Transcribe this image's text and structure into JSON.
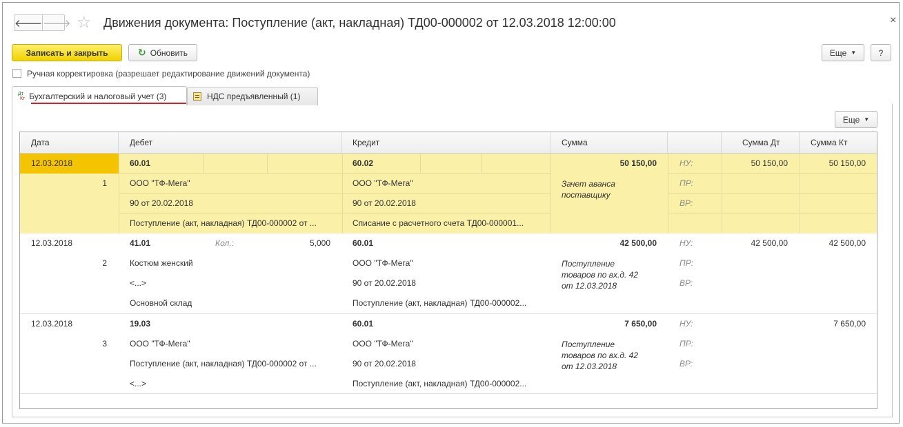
{
  "window": {
    "title": "Движения документа: Поступление (акт, накладная) ТД00-000002 от 12.03.2018 12:00:00",
    "close_glyph": "×",
    "back_glyph": "🡐",
    "forward_glyph": "🡒",
    "star_glyph": "☆"
  },
  "toolbar": {
    "save_close": "Записать и закрыть",
    "refresh": "Обновить",
    "more": "Еще",
    "help": "?"
  },
  "manual_correction": {
    "label": "Ручная корректировка (разрешает редактирование движений документа)",
    "checked": false
  },
  "tabs": [
    {
      "label": "Бухгалтерский и налоговый учет (3)",
      "icon": "dt-kt-icon",
      "active": true
    },
    {
      "label": "НДС предъявленный (1)",
      "icon": "vat-register-icon",
      "active": false
    }
  ],
  "tab_icon_text": {
    "dt": "Дт",
    "kt": "Кт"
  },
  "table": {
    "more": "Еще",
    "columns": {
      "date": "Дата",
      "debit": "Дебет",
      "credit": "Кредит",
      "sum": "Сумма",
      "sum_dt": "Сумма Дт",
      "sum_kt": "Сумма Кт"
    },
    "rows": [
      {
        "date": "12.03.2018",
        "num": "1",
        "debit": {
          "account": "60.01",
          "qty_label": "",
          "qty": "",
          "sub1": "ООО \"ТФ-Мега\"",
          "sub2": "90 от 20.02.2018",
          "sub3": "Поступление (акт, накладная) ТД00-000002 от ..."
        },
        "credit": {
          "account": "60.02",
          "sub1": "ООО \"ТФ-Мега\"",
          "sub2": "90 от 20.02.2018",
          "sub3": "Списание с расчетного счета ТД00-000001..."
        },
        "sum": "50 150,00",
        "content": [
          "Зачет аванса",
          "поставщику"
        ],
        "nu": "НУ:",
        "pr": "ПР:",
        "vr": "ВР:",
        "sum_dt": "50 150,00",
        "sum_kt": "50 150,00"
      },
      {
        "date": "12.03.2018",
        "num": "2",
        "debit": {
          "account": "41.01",
          "qty_label": "Кол.:",
          "qty": "5,000",
          "sub1": "Костюм женский",
          "sub2": "<...>",
          "sub3": "Основной склад"
        },
        "credit": {
          "account": "60.01",
          "sub1": "ООО \"ТФ-Мега\"",
          "sub2": "90 от 20.02.2018",
          "sub3": "Поступление (акт, накладная) ТД00-000002..."
        },
        "sum": "42 500,00",
        "content": [
          "Поступление",
          "товаров по вх.д. 42",
          "от 12.03.2018"
        ],
        "nu": "НУ:",
        "pr": "ПР:",
        "vr": "ВР:",
        "sum_dt": "42 500,00",
        "sum_kt": "42 500,00"
      },
      {
        "date": "12.03.2018",
        "num": "3",
        "debit": {
          "account": "19.03",
          "qty_label": "",
          "qty": "",
          "sub1": "ООО \"ТФ-Мега\"",
          "sub2": "Поступление (акт, накладная) ТД00-000002 от ...",
          "sub3": "<...>"
        },
        "credit": {
          "account": "60.01",
          "sub1": "ООО \"ТФ-Мега\"",
          "sub2": "90 от 20.02.2018",
          "sub3": "Поступление (акт, накладная) ТД00-000002..."
        },
        "sum": "7 650,00",
        "content": [
          "Поступление",
          "товаров по вх.д. 42",
          "от 12.03.2018"
        ],
        "nu": "НУ:",
        "pr": "ПР:",
        "vr": "ВР:",
        "sum_dt": "",
        "sum_kt": "7 650,00"
      }
    ]
  },
  "colors": {
    "primary_button": "#f0d200",
    "selected_row": "#fbf0a8",
    "selected_cell": "#f5c400",
    "tab_underline": "#d81f1f"
  }
}
